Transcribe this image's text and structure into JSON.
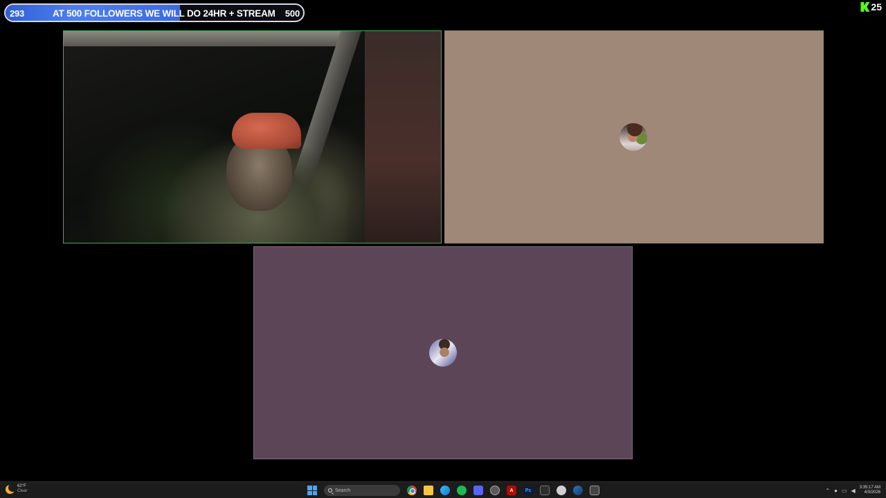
{
  "goal": {
    "current": "293",
    "title": "AT 500 FOLLOWERS WE WILL DO 24HR + STREAM",
    "target": "500",
    "progress_fraction": 0.586
  },
  "brand": {
    "badge_count": "25",
    "kick_color": "#53fc18"
  },
  "tiles": {
    "user2_bg": "#a08878",
    "user3_bg": "#5c4556",
    "active_border": "#3fae5a"
  },
  "taskbar": {
    "weather_temp": "62°F",
    "weather_condition": "Clear",
    "search_placeholder": "Search",
    "clock_time": "3:35:17 AM",
    "clock_date": "4/3/2026",
    "icons": [
      "start-icon",
      "chrome-icon",
      "file-explorer-icon",
      "edge-icon",
      "spotify-icon",
      "discord-icon",
      "obs-icon",
      "acrobat-icon",
      "photoshop-icon",
      "terminal-icon",
      "circle-app-icon",
      "steam-icon",
      "grid-app-icon"
    ],
    "acrobat_label": "A",
    "photoshop_label": "Ps"
  }
}
